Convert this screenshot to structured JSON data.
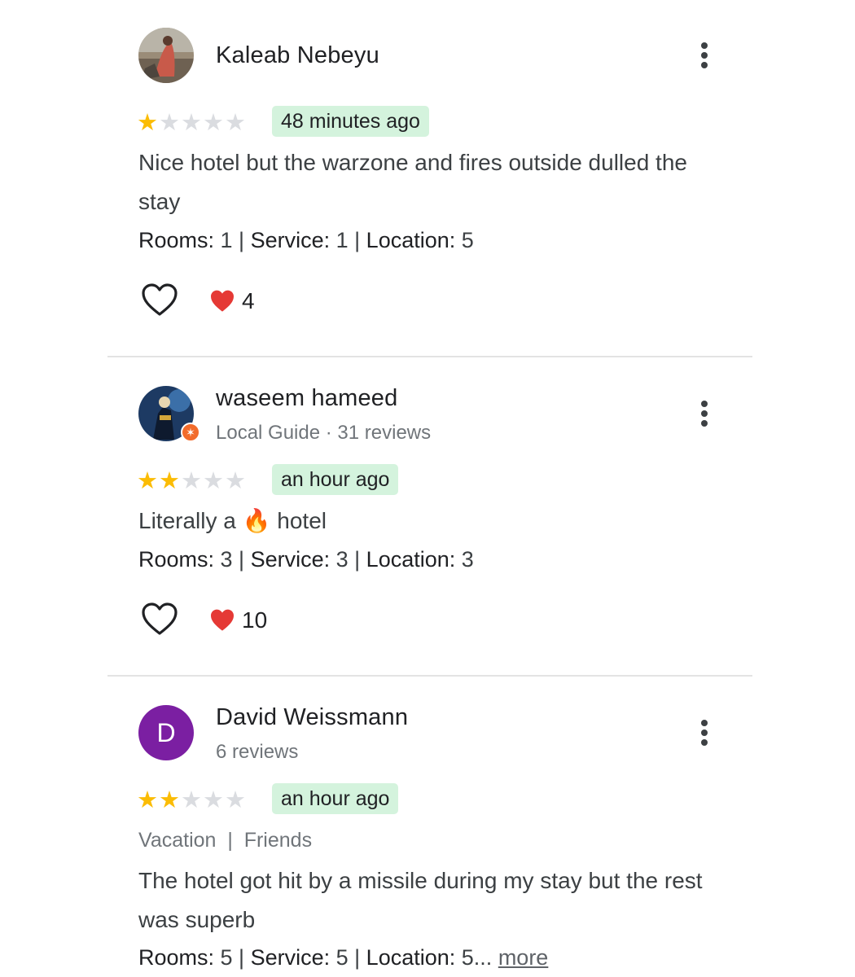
{
  "colors": {
    "star": "#fbbc04",
    "badge_bg": "#d4f3dd",
    "heart": "#e53935",
    "avatar_d": "#7b1fa2"
  },
  "reviews": [
    {
      "author": "Kaleab Nebeyu",
      "avatar": "photo",
      "stars": 1,
      "time": "48 minutes ago",
      "text": "Nice hotel but the warzone and fires outside dulled the stay",
      "ratings": {
        "rooms_label": "Rooms:",
        "rooms": " 1 | ",
        "service_label": "Service:",
        "service": " 1 | ",
        "location_label": "Location:",
        "location": " 5"
      },
      "reactions": "4"
    },
    {
      "author": "waseem hameed",
      "avatar": "photo",
      "sub": "Local Guide · 31 reviews",
      "stars": 2,
      "time": "an hour ago",
      "text_before": "Literally a ",
      "emoji": "🔥",
      "text_after": " hotel",
      "ratings": {
        "rooms_label": "Rooms:",
        "rooms": " 3 | ",
        "service_label": "Service:",
        "service": " 3 | ",
        "location_label": "Location:",
        "location": " 3"
      },
      "reactions": "10"
    },
    {
      "author": "David Weissmann",
      "avatar_letter": "D",
      "sub": "6 reviews",
      "stars": 2,
      "time": "an hour ago",
      "tags": "Vacation  |  Friends",
      "text": "The hotel got hit by a missile during my stay but the rest was superb",
      "ratings": {
        "rooms_label": "Rooms:",
        "rooms": " 5 | ",
        "service_label": "Service:",
        "service": " 5 | ",
        "location_label": "Location:",
        "location": " 5..."
      },
      "more": "more"
    }
  ]
}
